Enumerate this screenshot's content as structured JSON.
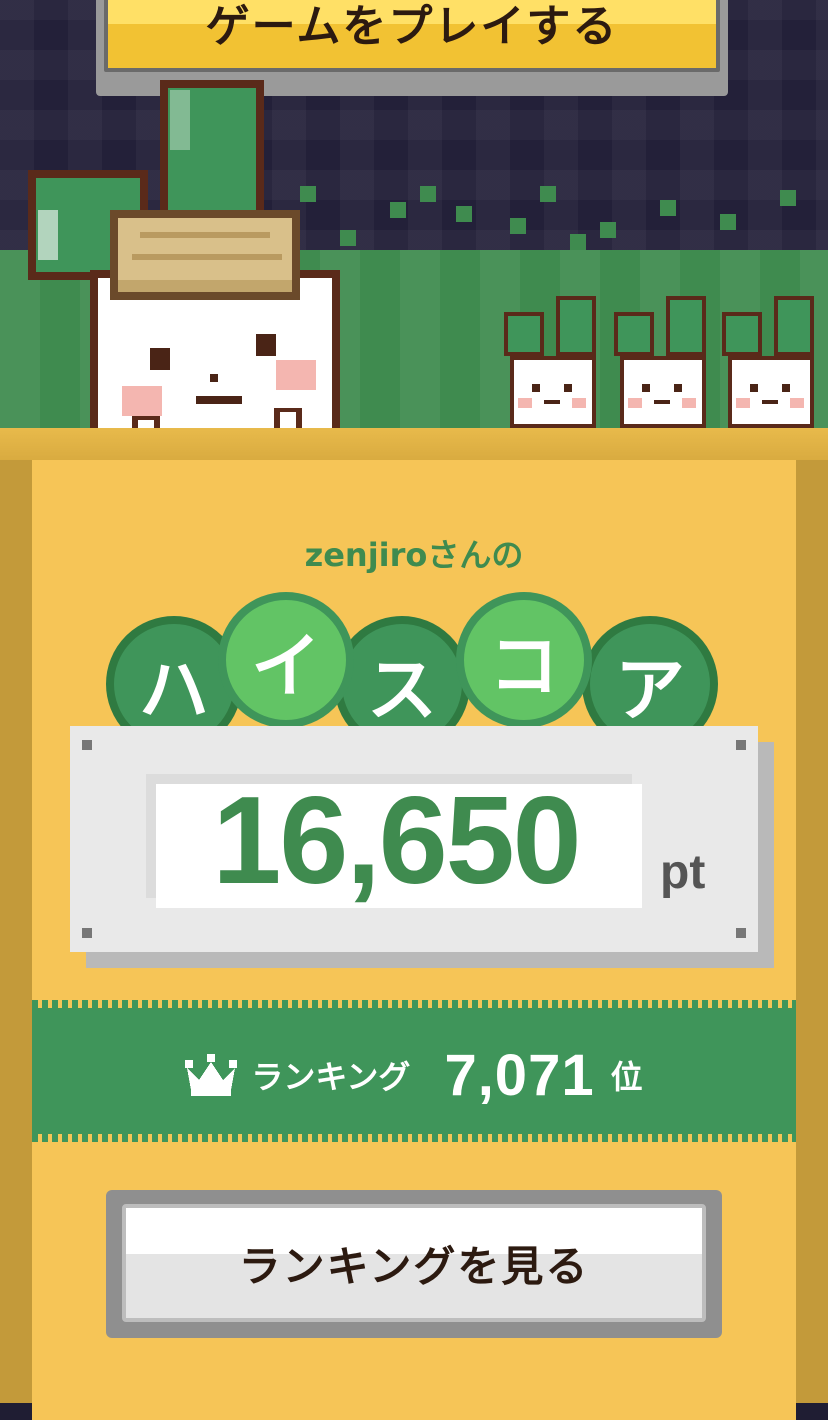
{
  "top": {
    "play_button_label": "ゲームをプレイする"
  },
  "score_card": {
    "username_line": "zenjiroさんの",
    "title_chars": [
      "ハ",
      "イ",
      "ス",
      "コ",
      "ア"
    ],
    "score": "16,650",
    "unit": "pt"
  },
  "ranking": {
    "label": "ランキング",
    "value": "7,071",
    "suffix": "位",
    "icon": "crown-icon"
  },
  "buttons": {
    "view_ranking_label": "ランキングを見る"
  },
  "colors": {
    "brand_green": "#3f8b4f",
    "panel_yellow": "#f6c557",
    "button_gold": "#f2c233"
  }
}
